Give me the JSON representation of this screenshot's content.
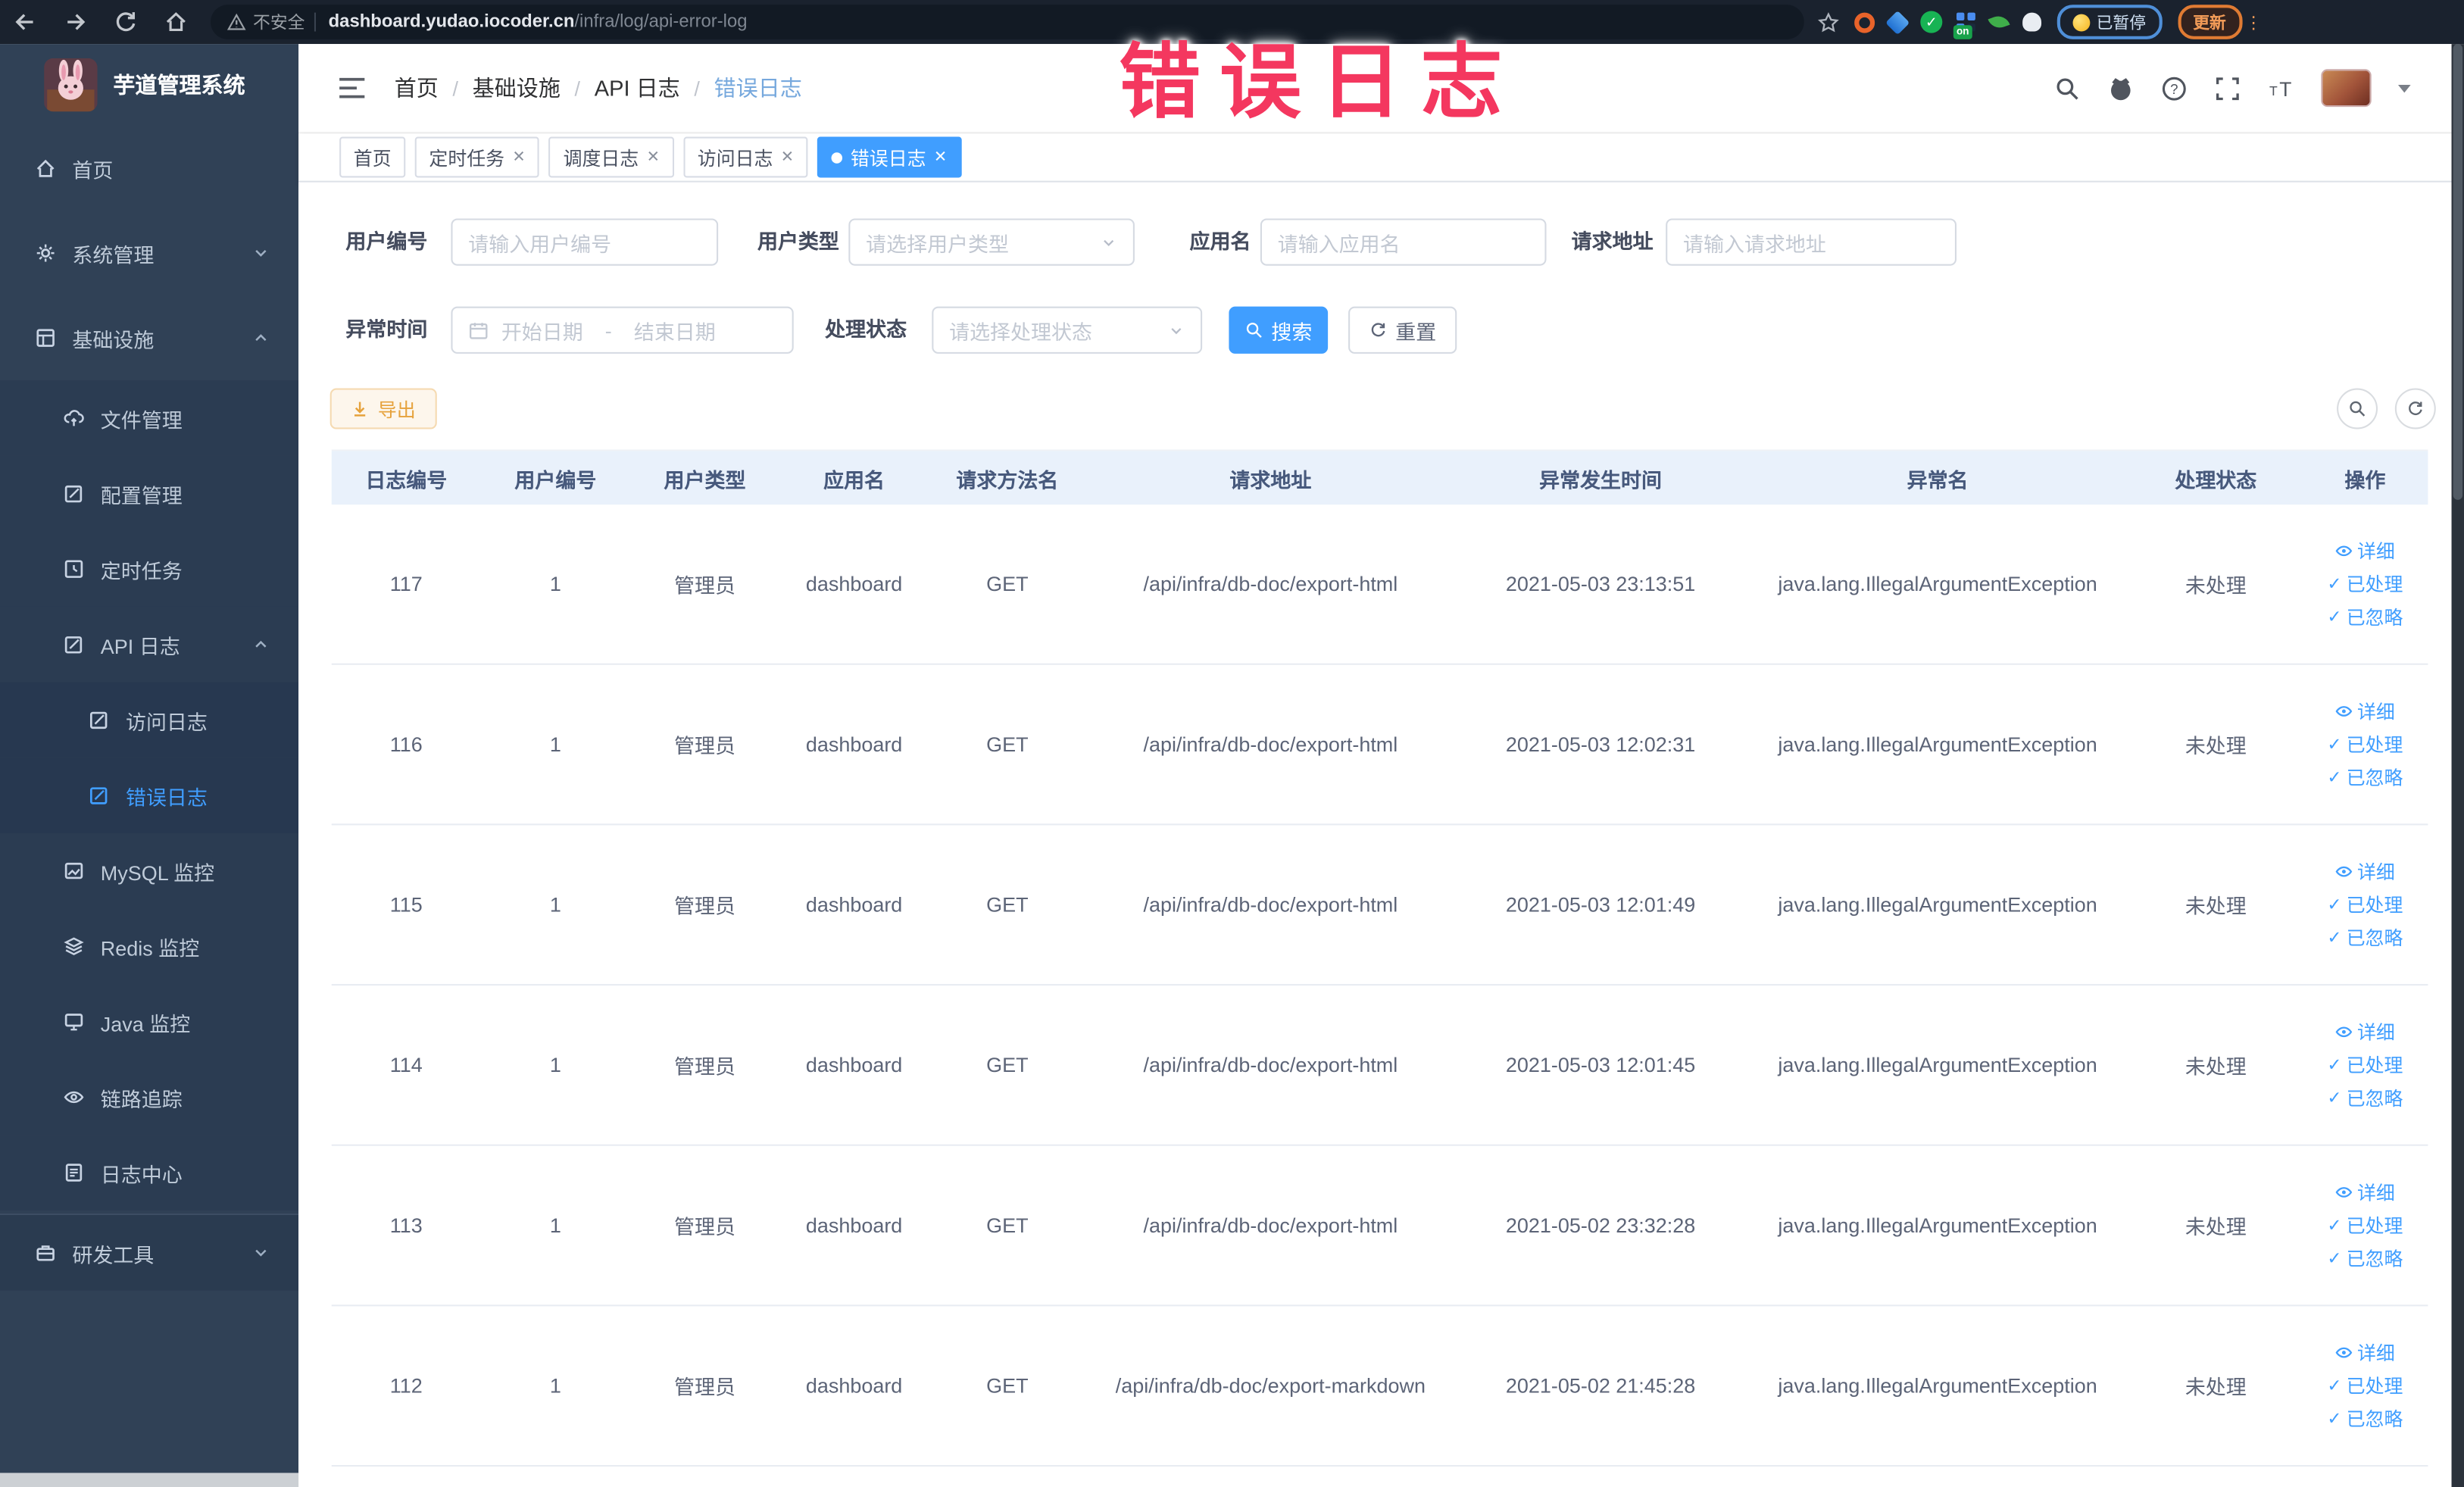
{
  "colors": {
    "accent": "#409eff",
    "annotation": "#f4375f",
    "warning": "#e6a23c",
    "sidebar_bg": "#304156",
    "active_tab": "#409eff"
  },
  "annotation": {
    "text": "错误日志"
  },
  "browser": {
    "security_label": "不安全",
    "url_domain": "dashboard.yudao.iocoder.cn",
    "url_path": "/infra/log/api-error-log",
    "on_badge": "on",
    "paused_badge": "已暂停",
    "update_button": "更新",
    "kebab": "⋮"
  },
  "sidebar": {
    "title": "芋道管理系统",
    "items": [
      {
        "label": "首页"
      },
      {
        "label": "系统管理"
      },
      {
        "label": "基础设施"
      },
      {
        "label": "文件管理"
      },
      {
        "label": "配置管理"
      },
      {
        "label": "定时任务"
      },
      {
        "label": "API 日志"
      },
      {
        "label": "访问日志"
      },
      {
        "label": "错误日志"
      },
      {
        "label": "MySQL 监控"
      },
      {
        "label": "Redis 监控"
      },
      {
        "label": "Java 监控"
      },
      {
        "label": "链路追踪"
      },
      {
        "label": "日志中心"
      },
      {
        "label": "研发工具"
      }
    ]
  },
  "header": {
    "breadcrumb": [
      "首页",
      "基础设施",
      "API 日志",
      "错误日志"
    ]
  },
  "tabs": [
    {
      "label": "首页",
      "closable": false,
      "active": false
    },
    {
      "label": "定时任务",
      "closable": true,
      "active": false
    },
    {
      "label": "调度日志",
      "closable": true,
      "active": false
    },
    {
      "label": "访问日志",
      "closable": true,
      "active": false
    },
    {
      "label": "错误日志",
      "closable": true,
      "active": true
    }
  ],
  "filters": {
    "user_no": {
      "label": "用户编号",
      "placeholder": "请输入用户编号"
    },
    "user_type": {
      "label": "用户类型",
      "placeholder": "请选择用户类型"
    },
    "app_name": {
      "label": "应用名",
      "placeholder": "请输入应用名"
    },
    "req_url": {
      "label": "请求地址",
      "placeholder": "请输入请求地址"
    },
    "exc_time": {
      "label": "异常时间",
      "start": "开始日期",
      "sep": "-",
      "end": "结束日期"
    },
    "status": {
      "label": "处理状态",
      "placeholder": "请选择处理状态"
    },
    "search": "搜索",
    "reset": "重置"
  },
  "toolbar": {
    "export": "导出"
  },
  "table": {
    "columns": [
      "日志编号",
      "用户编号",
      "用户类型",
      "应用名",
      "请求方法名",
      "请求地址",
      "异常发生时间",
      "异常名",
      "处理状态",
      "操作"
    ],
    "actions": [
      "详细",
      "已处理",
      "已忽略"
    ],
    "rows": [
      {
        "log_id": "117",
        "user_id": "1",
        "user_type": "管理员",
        "app": "dashboard",
        "method": "GET",
        "url": "/api/infra/db-doc/export-html",
        "time": "2021-05-03 23:13:51",
        "exception": "java.lang.IllegalArgumentException",
        "status": "未处理"
      },
      {
        "log_id": "116",
        "user_id": "1",
        "user_type": "管理员",
        "app": "dashboard",
        "method": "GET",
        "url": "/api/infra/db-doc/export-html",
        "time": "2021-05-03 12:02:31",
        "exception": "java.lang.IllegalArgumentException",
        "status": "未处理"
      },
      {
        "log_id": "115",
        "user_id": "1",
        "user_type": "管理员",
        "app": "dashboard",
        "method": "GET",
        "url": "/api/infra/db-doc/export-html",
        "time": "2021-05-03 12:01:49",
        "exception": "java.lang.IllegalArgumentException",
        "status": "未处理"
      },
      {
        "log_id": "114",
        "user_id": "1",
        "user_type": "管理员",
        "app": "dashboard",
        "method": "GET",
        "url": "/api/infra/db-doc/export-html",
        "time": "2021-05-03 12:01:45",
        "exception": "java.lang.IllegalArgumentException",
        "status": "未处理"
      },
      {
        "log_id": "113",
        "user_id": "1",
        "user_type": "管理员",
        "app": "dashboard",
        "method": "GET",
        "url": "/api/infra/db-doc/export-html",
        "time": "2021-05-02 23:32:28",
        "exception": "java.lang.IllegalArgumentException",
        "status": "未处理"
      },
      {
        "log_id": "112",
        "user_id": "1",
        "user_type": "管理员",
        "app": "dashboard",
        "method": "GET",
        "url": "/api/infra/db-doc/export-markdown",
        "time": "2021-05-02 21:45:28",
        "exception": "java.lang.IllegalArgumentException",
        "status": "未处理"
      }
    ]
  }
}
